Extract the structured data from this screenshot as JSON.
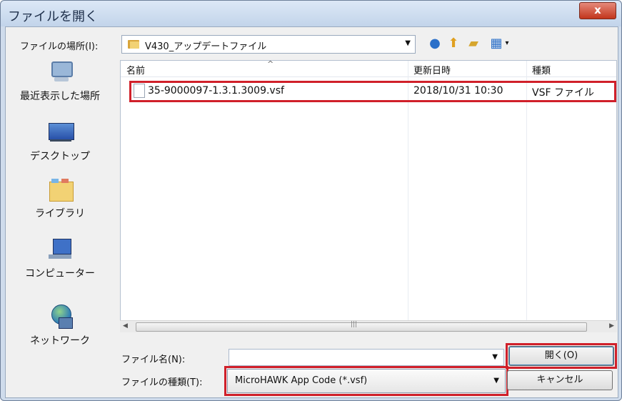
{
  "window": {
    "title": "ファイルを開く",
    "close_symbol": "x"
  },
  "location": {
    "label": "ファイルの場所(I):",
    "current_folder": "V430_アップデートファイル"
  },
  "toolbar": {
    "icons": [
      "back-icon",
      "up-folder-icon",
      "new-folder-icon",
      "views-icon"
    ]
  },
  "places": [
    {
      "label": "最近表示した場所",
      "icon": "recent-places-icon"
    },
    {
      "label": "デスクトップ",
      "icon": "desktop-icon"
    },
    {
      "label": "ライブラリ",
      "icon": "library-icon"
    },
    {
      "label": "コンピューター",
      "icon": "computer-icon"
    },
    {
      "label": "ネットワーク",
      "icon": "network-icon"
    }
  ],
  "columns": [
    "名前",
    "更新日時",
    "種類"
  ],
  "files": [
    {
      "name": "35-9000097-1.3.1.3009.vsf",
      "modified": "2018/10/31 10:30",
      "type": "VSF ファイル"
    }
  ],
  "fields": {
    "filename_label": "ファイル名(N):",
    "filename_value": "",
    "filetype_label": "ファイルの種類(T):",
    "filetype_value": "MicroHAWK App Code (*.vsf)"
  },
  "buttons": {
    "open": "開く(O)",
    "cancel": "キャンセル"
  },
  "colors": {
    "highlight": "#d0202a",
    "title_bar": "#c2d4ea"
  }
}
